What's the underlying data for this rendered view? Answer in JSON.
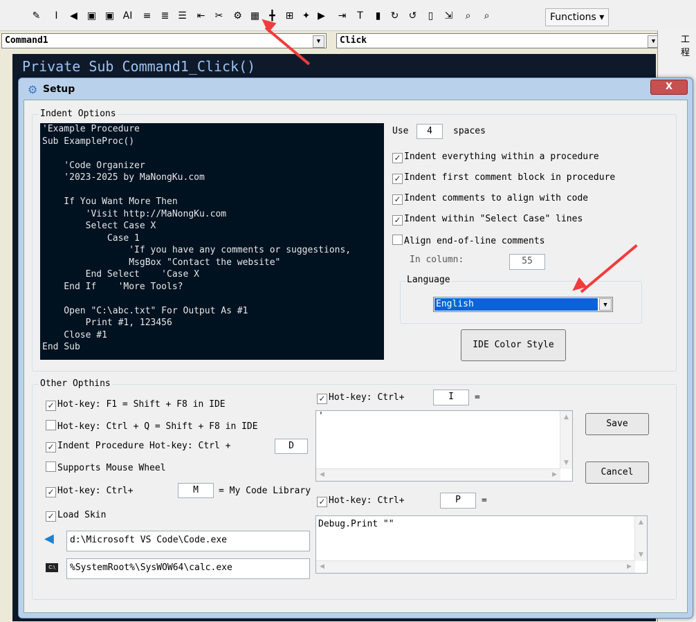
{
  "toolbar": {
    "functions_label": "Functions ▾",
    "icons": [
      "pencil-icon",
      "italic-icon",
      "vscode-icon",
      "save-icon",
      "save-all-icon",
      "ai-icon",
      "align-left-icon",
      "indent-icon",
      "list-icon",
      "outdent-icon",
      "organizer-icon",
      "settings-icon",
      "grid-icon",
      "table-icon",
      "table2-icon",
      "comment-icon",
      "play-icon",
      "indent2-icon",
      "text-icon",
      "bookmark-icon",
      "cycle-icon",
      "cycle2-icon",
      "page-icon",
      "export-icon",
      "find-icon",
      "find-next-icon"
    ]
  },
  "object_combo": {
    "value": "Command1"
  },
  "event_combo": {
    "value": "Click"
  },
  "editor": {
    "code_line": "Private Sub Command1_Click()"
  },
  "right_panel": {
    "title": "工程"
  },
  "dialog": {
    "title": "Setup",
    "close_label": "X",
    "indent_options": {
      "label": "Indent Options",
      "preview_lines": [
        "'Example Procedure",
        "Sub ExampleProc()",
        "",
        "    'Code Organizer",
        "    '2023-2025 by MaNongKu.com",
        "",
        "    If You Want More Then",
        "        'Visit http://MaNongKu.com",
        "        Select Case X",
        "            Case 1",
        "                'If you have any comments or suggestions,",
        "                MsgBox \"Contact the website\"",
        "        End Select    'Case X",
        "    End If    'More Tools?",
        "",
        "    Open \"C:\\abc.txt\" For Output As #1",
        "        Print #1, 123456",
        "    Close #1",
        "End Sub"
      ],
      "use_label": "Use",
      "spaces_value": "4",
      "spaces_label": "spaces",
      "checkboxes": [
        {
          "label": "Indent everything within a procedure",
          "checked": true
        },
        {
          "label": "Indent first comment block in procedure",
          "checked": true
        },
        {
          "label": "Indent comments to align with code",
          "checked": true
        },
        {
          "label": "Indent within \"Select Case\" lines",
          "checked": true
        },
        {
          "label": "Align end-of-line comments",
          "checked": false
        }
      ],
      "in_column_label": "In column:",
      "in_column_value": "55",
      "language_label": "Language",
      "language_value": "English",
      "ide_color_label": "IDE Color Style"
    },
    "other_options": {
      "label": "Other Opthins",
      "hotkey_f1": {
        "label": "Hot-key: F1 = Shift + F8 in IDE",
        "checked": true
      },
      "hotkey_ctrl_q": {
        "label": "Hot-key: Ctrl + Q = Shift + F8 in IDE",
        "checked": false
      },
      "indent_proc": {
        "label": "Indent Procedure Hot-key: Ctrl +",
        "checked": true,
        "key": "D"
      },
      "mouse_wheel": {
        "label": "Supports Mouse Wheel",
        "checked": false
      },
      "hotkey_m": {
        "label": "Hot-key: Ctrl+",
        "checked": true,
        "key": "M",
        "suffix": "= My Code Library"
      },
      "load_skin": {
        "label": "Load Skin",
        "checked": true
      },
      "vscode_path": "d:\\Microsoft VS Code\\Code.exe",
      "calc_path": "%SystemRoot%\\SysWOW64\\calc.exe",
      "hotkey_i": {
        "label": "Hot-key: Ctrl+",
        "checked": true,
        "key": "I",
        "eq": "=",
        "text": "'"
      },
      "hotkey_p": {
        "label": "Hot-key: Ctrl+",
        "checked": true,
        "key": "P",
        "eq": "=",
        "text": "Debug.Print \"\""
      },
      "save_label": "Save",
      "cancel_label": "Cancel"
    }
  },
  "colors": {
    "annotation_arrow": "#f23b3b",
    "selection": "#0a64d8",
    "preview_bg": "#001120"
  }
}
